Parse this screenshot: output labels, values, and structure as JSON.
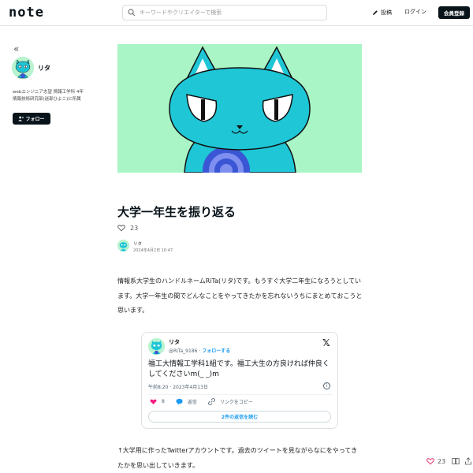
{
  "header": {
    "logo": "note",
    "search_placeholder": "キーワードやクリエイターで検索",
    "post_label": "投稿",
    "login_label": "ログイン",
    "signup_label": "会員登録"
  },
  "sidebar": {
    "collapse_glyph": "«",
    "name": "リタ",
    "bio_line1": "webエンジニア志望 情報工学科 4年",
    "bio_line2": "情報技術研究部(迷部ひよこ)に所属",
    "follow_label": "フォロー"
  },
  "article": {
    "title": "大学一年生を振り返る",
    "like_count": "23",
    "author_name": "リタ",
    "date": "2024年4月2日 10:47",
    "paragraph1": "情報系大学生のハンドルネームRiTa(リタ)です。もうすぐ大学二年生になろうとしています。大学一年生の間でどんなことをやってきたかを忘れないうちにまとめておこうと思います。",
    "paragraph2": "↑大学用に作ったTwitterアカウントです。過去のツイートを見ながらなにをやってきたかを思い出していきます。"
  },
  "tweet": {
    "name": "リタ",
    "handle": "@RiTa_9186",
    "separator": " · ",
    "follow_label": "フォローする",
    "x_glyph": "𝕏",
    "text": "福工大情報工学科1組です。福工大生の方良ければ仲良くしてくださいm(_ _)m",
    "time": "午前8:20 · 2023年4月13日",
    "info_glyph": "i",
    "likes": "8",
    "reply_label": "返信",
    "copy_label": "リンクをコピー",
    "replies_label": "2件の返信を読む"
  },
  "floating": {
    "like_count": "23"
  },
  "colors": {
    "accent_dark": "#08131a",
    "hero_bg": "#a9f5c6",
    "cat_body": "#1ec6d6",
    "twitter_blue": "#1d9bf0",
    "like_pink": "#f91880"
  }
}
